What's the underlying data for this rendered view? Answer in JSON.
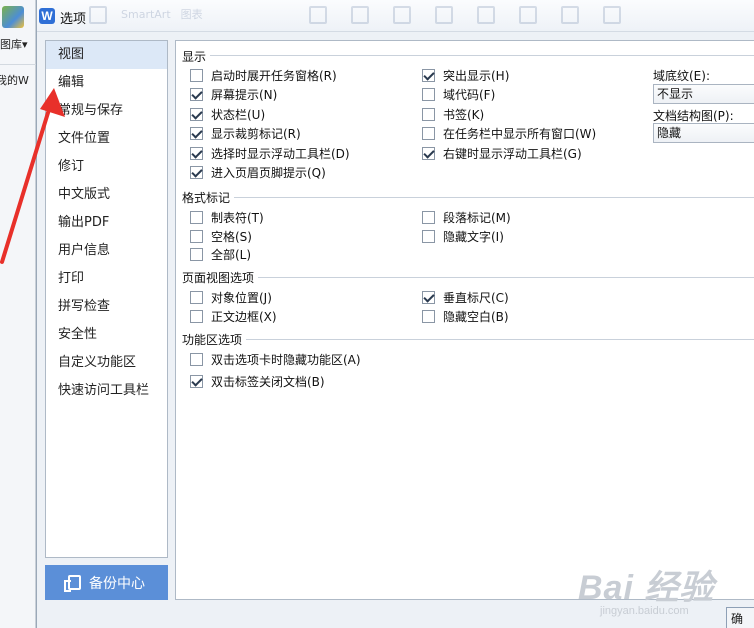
{
  "background_app": {
    "library_label": "图库",
    "dropdown_glyph": "▾",
    "mine_label": "我的W"
  },
  "dialog": {
    "title": "选项",
    "logo_letter": "W",
    "ghost_labels": [
      "SmartArt",
      "图表"
    ]
  },
  "sidebar": {
    "items": [
      {
        "label": "视图",
        "selected": true
      },
      {
        "label": "编辑",
        "selected": false
      },
      {
        "label": "常规与保存",
        "selected": false
      },
      {
        "label": "文件位置",
        "selected": false
      },
      {
        "label": "修订",
        "selected": false
      },
      {
        "label": "中文版式",
        "selected": false
      },
      {
        "label": "输出PDF",
        "selected": false
      },
      {
        "label": "用户信息",
        "selected": false
      },
      {
        "label": "打印",
        "selected": false
      },
      {
        "label": "拼写检查",
        "selected": false
      },
      {
        "label": "安全性",
        "selected": false
      },
      {
        "label": "自定义功能区",
        "selected": false
      },
      {
        "label": "快速访问工具栏",
        "selected": false
      }
    ],
    "backup_button": "备份中心"
  },
  "sections": {
    "display": {
      "title": "显示",
      "options": [
        {
          "label": "启动时展开任务窗格(R)",
          "checked": false
        },
        {
          "label": "屏幕提示(N)",
          "checked": true
        },
        {
          "label": "状态栏(U)",
          "checked": true
        },
        {
          "label": "显示裁剪标记(R)",
          "checked": true
        },
        {
          "label": "选择时显示浮动工具栏(D)",
          "checked": true
        },
        {
          "label": "进入页眉页脚提示(Q)",
          "checked": true
        },
        {
          "label": "突出显示(H)",
          "checked": true
        },
        {
          "label": "域代码(F)",
          "checked": false
        },
        {
          "label": "书签(K)",
          "checked": false
        },
        {
          "label": "在任务栏中显示所有窗口(W)",
          "checked": false
        },
        {
          "label": "右键时显示浮动工具栏(G)",
          "checked": true
        }
      ],
      "field_shading_label": "域底纹(E):",
      "field_shading_value": "不显示",
      "doc_map_label": "文档结构图(P):",
      "doc_map_value": "隐藏"
    },
    "format_marks": {
      "title": "格式标记",
      "options": [
        {
          "label": "制表符(T)",
          "checked": false
        },
        {
          "label": "空格(S)",
          "checked": false
        },
        {
          "label": "全部(L)",
          "checked": false
        },
        {
          "label": "段落标记(M)",
          "checked": false
        },
        {
          "label": "隐藏文字(I)",
          "checked": false
        }
      ]
    },
    "page_view": {
      "title": "页面视图选项",
      "options": [
        {
          "label": "对象位置(J)",
          "checked": false
        },
        {
          "label": "正文边框(X)",
          "checked": false
        },
        {
          "label": "垂直标尺(C)",
          "checked": true
        },
        {
          "label": "隐藏空白(B)",
          "checked": false
        }
      ]
    },
    "ribbon": {
      "title": "功能区选项",
      "options": [
        {
          "label": "双击选项卡时隐藏功能区(A)",
          "checked": false
        },
        {
          "label": "双击标签关闭文档(B)",
          "checked": true
        }
      ]
    }
  },
  "footer": {
    "ok_button": "确"
  },
  "watermark": {
    "main": "Bai 经验",
    "sub": "jingyan.baidu.com"
  },
  "colors": {
    "accent": "#5b8fd8",
    "selected_bg": "#dce8f7",
    "annotation_arrow": "#e8302a"
  }
}
